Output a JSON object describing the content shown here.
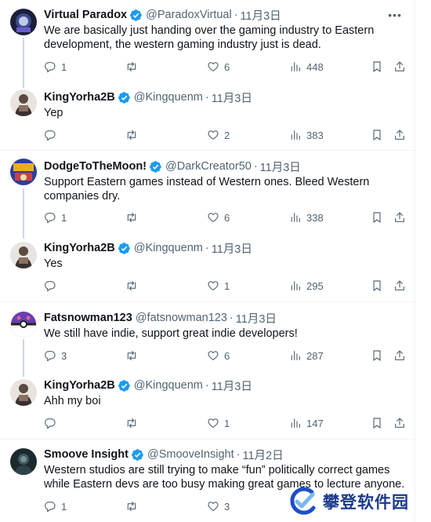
{
  "tweets": [
    {
      "name": "Virtual Paradox",
      "handle": "@ParadoxVirtual",
      "dot": "·",
      "date": "11月3日",
      "text": "We are basically just handing over the gaming industry to Eastern development, the western gaming industry just is dead.",
      "replies": "1",
      "retweets": "",
      "likes": "6",
      "views": "448",
      "avatar": "virtual-paradox-avatar"
    },
    {
      "name": "KingYorha2B",
      "handle": "@Kingquenm",
      "dot": "·",
      "date": "11月3日",
      "text": "Yep",
      "replies": "",
      "retweets": "",
      "likes": "2",
      "views": "383",
      "avatar": "kingyorha-avatar"
    },
    {
      "name": "DodgeToTheMoon!",
      "handle": "@DarkCreator50",
      "dot": "·",
      "date": "11月3日",
      "text": "Support Eastern games instead of Western ones. Bleed Western companies dry.",
      "replies": "1",
      "retweets": "",
      "likes": "6",
      "views": "338",
      "avatar": "dodgetothemoon-avatar"
    },
    {
      "name": "KingYorha2B",
      "handle": "@Kingquenm",
      "dot": "·",
      "date": "11月3日",
      "text": "Yes",
      "replies": "",
      "retweets": "",
      "likes": "1",
      "views": "295",
      "avatar": "kingyorha-avatar"
    },
    {
      "name": "Fatsnowman123",
      "handle": "@fatsnowman123",
      "dot": "·",
      "date": "11月3日",
      "text": "We still have indie, support great indie developers!",
      "replies": "3",
      "retweets": "",
      "likes": "6",
      "views": "287",
      "avatar": "fatsnowman-avatar"
    },
    {
      "name": "KingYorha2B",
      "handle": "@Kingquenm",
      "dot": "·",
      "date": "11月3日",
      "text": "Ahh my boi",
      "replies": "",
      "retweets": "",
      "likes": "1",
      "views": "147",
      "avatar": "kingyorha-avatar"
    },
    {
      "name": "Smoove Insight",
      "handle": "@SmooveInsight",
      "dot": "·",
      "date": "11月2日",
      "text": "Western studios are still trying to make “fun” politically correct games while Eastern devs are too busy making great games to lecture anyone.",
      "replies": "1",
      "retweets": "",
      "likes": "3",
      "views": "",
      "avatar": "smoove-avatar"
    }
  ],
  "watermark": {
    "text": "攀登软件园"
  },
  "icons": {
    "verified": "verified-badge-icon",
    "more": "more-icon",
    "reply": "reply-icon",
    "retweet": "retweet-icon",
    "like": "like-icon",
    "views": "views-icon",
    "bookmark": "bookmark-icon",
    "share": "share-icon"
  },
  "colors": {
    "verified": "#1d9bf0",
    "secondary_text": "#536471",
    "thread_line": "#cfd9de",
    "separator": "#eff3f4",
    "watermark": "#1c3a8c"
  }
}
